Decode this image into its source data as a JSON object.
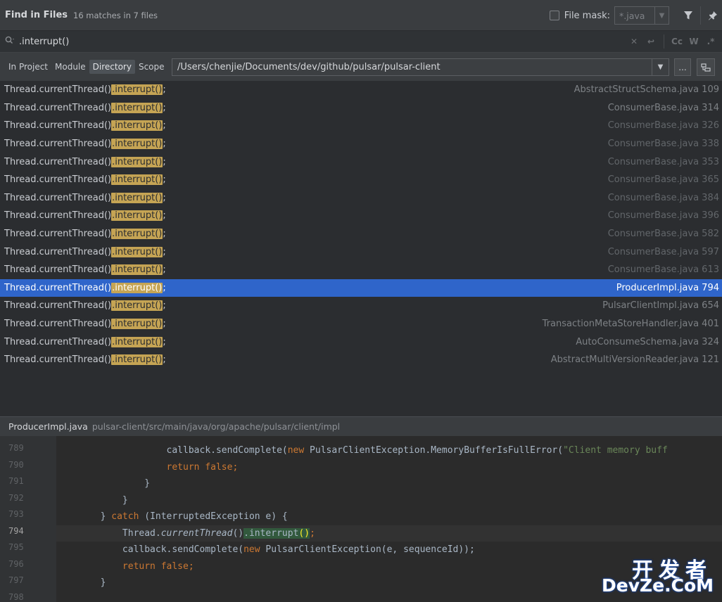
{
  "header": {
    "title": "Find in Files",
    "count": "16 matches in 7 files",
    "file_mask_label": "File mask:",
    "file_mask_value": "*.java"
  },
  "search": {
    "query": ".interrupt()",
    "case_label": "Cc",
    "words_label": "W",
    "regex_label": ".*"
  },
  "scope": {
    "tabs": [
      {
        "label": "In Project"
      },
      {
        "label": "Module"
      },
      {
        "label": "Directory"
      },
      {
        "label": "Scope"
      }
    ],
    "active_tab": "Directory",
    "path": "/Users/chenjie/Documents/dev/github/pulsar/pulsar-client",
    "browse_label": "..."
  },
  "results": [
    {
      "prefix": "Thread.currentThread()",
      "match": ".interrupt()",
      "suffix": ";",
      "file": "AbstractStructSchema.java 109"
    },
    {
      "prefix": "Thread.currentThread()",
      "match": ".interrupt()",
      "suffix": ";",
      "file": "ConsumerBase.java 314"
    },
    {
      "prefix": "Thread.currentThread()",
      "match": ".interrupt()",
      "suffix": ";",
      "file": "ConsumerBase.java 326"
    },
    {
      "prefix": "Thread.currentThread()",
      "match": ".interrupt()",
      "suffix": ";",
      "file": "ConsumerBase.java 338"
    },
    {
      "prefix": "Thread.currentThread()",
      "match": ".interrupt()",
      "suffix": ";",
      "file": "ConsumerBase.java 353"
    },
    {
      "prefix": "Thread.currentThread()",
      "match": ".interrupt()",
      "suffix": ";",
      "file": "ConsumerBase.java 365"
    },
    {
      "prefix": "Thread.currentThread()",
      "match": ".interrupt()",
      "suffix": ";",
      "file": "ConsumerBase.java 384"
    },
    {
      "prefix": "Thread.currentThread()",
      "match": ".interrupt()",
      "suffix": ";",
      "file": "ConsumerBase.java 396"
    },
    {
      "prefix": "Thread.currentThread()",
      "match": ".interrupt()",
      "suffix": ";",
      "file": "ConsumerBase.java 582"
    },
    {
      "prefix": "Thread.currentThread()",
      "match": ".interrupt()",
      "suffix": ";",
      "file": "ConsumerBase.java 597"
    },
    {
      "prefix": "Thread.currentThread()",
      "match": ".interrupt()",
      "suffix": ";",
      "file": "ConsumerBase.java 613"
    },
    {
      "prefix": "Thread.currentThread()",
      "match": ".interrupt()",
      "suffix": ";",
      "file": "ProducerImpl.java 794"
    },
    {
      "prefix": "Thread.currentThread()",
      "match": ".interrupt()",
      "suffix": ";",
      "file": "PulsarClientImpl.java 654"
    },
    {
      "prefix": "Thread.currentThread()",
      "match": ".interrupt()",
      "suffix": ";",
      "file": "TransactionMetaStoreHandler.java 401"
    },
    {
      "prefix": "Thread.currentThread()",
      "match": ".interrupt()",
      "suffix": ";",
      "file": "AutoConsumeSchema.java 324"
    },
    {
      "prefix": "Thread.currentThread()",
      "match": ".interrupt()",
      "suffix": ";",
      "file": "AbstractMultiVersionReader.java 121"
    }
  ],
  "preview": {
    "file_name": "ProducerImpl.java",
    "file_path": "pulsar-client/src/main/java/org/apache/pulsar/client/impl",
    "line_numbers": [
      "789",
      "790",
      "791",
      "792",
      "793",
      "794",
      "795",
      "796",
      "797",
      "798"
    ],
    "lines": {
      "l789_a": "                    callback.sendComplete(",
      "l789_kw": "new",
      "l789_b": " PulsarClientException.MemoryBufferIsFullError(",
      "l789_str": "\"Client memory buff",
      "l790_kw": "                    return false",
      "l790_b": ";",
      "l791": "                }",
      "l792": "            }",
      "l793_a": "        } ",
      "l793_kw": "catch",
      "l793_b": " (InterruptedException e) {",
      "l794_a": "            Thread.",
      "l794_it": "currentThread",
      "l794_b": "()",
      "l794_hl": ".interrupt",
      "l794_paren": "()",
      "l794_c": ";",
      "l795_a": "            callback.sendComplete(",
      "l795_kw": "new",
      "l795_b": " PulsarClientException(e, sequenceId));",
      "l796_kw": "            return false",
      "l796_b": ";",
      "l797": "        }"
    }
  },
  "watermark": {
    "top": "开发者",
    "bottom": "DevZe.CoM"
  }
}
